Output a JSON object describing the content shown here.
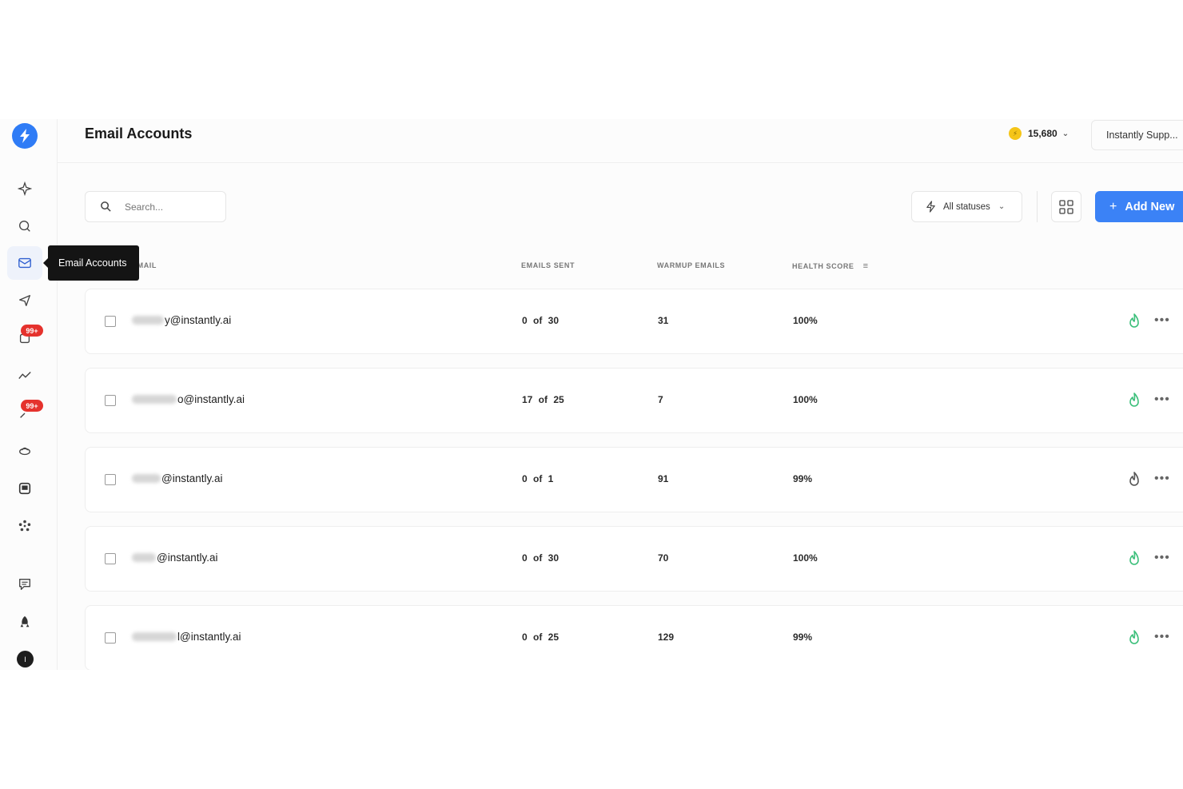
{
  "header": {
    "title": "Email Accounts",
    "credits": "15,680",
    "workspace": "Instantly Supp..."
  },
  "tooltip": "Email Accounts",
  "sidebar": {
    "badges": [
      "99+",
      "99+"
    ],
    "avatar_initial": "I"
  },
  "toolbar": {
    "search_placeholder": "Search...",
    "status_filter": "All statuses",
    "add_new": "Add New"
  },
  "table": {
    "columns": [
      "EMAIL",
      "EMAILS SENT",
      "WARMUP EMAILS",
      "HEALTH SCORE"
    ],
    "rows": [
      {
        "email_visible": "y@instantly.ai",
        "emails_sent": "0  of  30",
        "warmup": "31",
        "health": "100%",
        "warmup_active": true
      },
      {
        "email_visible": "o@instantly.ai",
        "emails_sent": "17  of  25",
        "warmup": "7",
        "health": "100%",
        "warmup_active": true
      },
      {
        "email_visible": "@instantly.ai",
        "emails_sent": "0  of  1",
        "warmup": "91",
        "health": "99%",
        "warmup_active": false
      },
      {
        "email_visible": "@instantly.ai",
        "emails_sent": "0  of  30",
        "warmup": "70",
        "health": "100%",
        "warmup_active": true
      },
      {
        "email_visible": "l@instantly.ai",
        "emails_sent": "0  of  25",
        "warmup": "129",
        "health": "99%",
        "warmup_active": true
      }
    ]
  },
  "colors": {
    "accent": "#3b82f6",
    "warmup_on": "#3bbf7a",
    "warmup_off": "#555555",
    "badge": "#e5322d"
  }
}
